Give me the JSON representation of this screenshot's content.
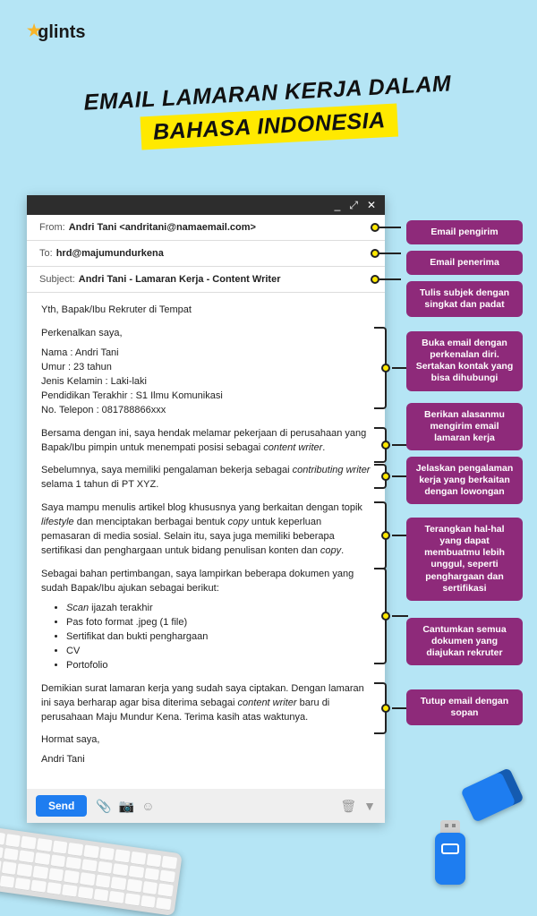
{
  "logo": "glints",
  "title_line1": "EMAIL LAMARAN KERJA DALAM",
  "title_line2": "BAHASA INDONESIA",
  "email": {
    "from_label": "From:",
    "from_value": "Andri Tani <andritani@namaemail.com>",
    "to_label": "To:",
    "to_value": "hrd@majumundurkena",
    "subject_label": "Subject:",
    "subject_value": "Andri Tani - Lamaran Kerja - Content Writer",
    "salutation": "Yth, Bapak/Ibu Rekruter di Tempat",
    "intro_lead": "Perkenalkan saya,",
    "intro_lines": [
      "Nama : Andri Tani",
      "Umur  : 23 tahun",
      "Jenis Kelamin : Laki-laki",
      "Pendidikan Terakhir  : S1 Ilmu Komunikasi",
      "No. Telepon  : 081788866xxx"
    ],
    "reason_html": "Bersama dengan ini, saya hendak melamar pekerjaan di perusahaan yang Bapak/Ibu pimpin untuk menempati posisi sebagai <em>content writer</em>.",
    "experience_html": "Sebelumnya, saya memiliki pengalaman bekerja sebagai <em>contributing writer</em> selama 1 tahun di PT XYZ.",
    "strength_html": "Saya mampu menulis artikel blog khususnya yang berkaitan dengan topik <em>lifestyle</em> dan menciptakan berbagai bentuk <em>copy</em> untuk keperluan pemasaran di media sosial. Selain itu, saya juga memiliki beberapa sertifikasi dan penghargaan untuk bidang penulisan konten dan <em>copy</em>.",
    "docs_lead": "Sebagai bahan pertimbangan, saya lampirkan beberapa dokumen yang sudah Bapak/Ibu ajukan sebagai berikut:",
    "docs": [
      "Scan ijazah terakhir",
      "Pas foto format .jpeg (1 file)",
      "Sertifikat dan bukti penghargaan",
      "CV",
      "Portofolio"
    ],
    "closing_html": "Demikian surat lamaran kerja yang sudah saya ciptakan. Dengan lamaran ini saya berharap agar bisa diterima sebagai <em>content writer</em> baru di perusahaan Maju Mundur Kena. Terima kasih atas waktunya.",
    "signoff1": "Hormat saya,",
    "signoff2": "Andri Tani",
    "send": "Send"
  },
  "annotations": {
    "from": "Email pengirim",
    "to": "Email penerima",
    "subject": "Tulis subjek dengan singkat dan padat",
    "intro": "Buka email dengan perkenalan diri. Sertakan kontak yang bisa dihubungi",
    "reason": "Berikan alasanmu mengirim email lamaran kerja",
    "experience": "Jelaskan pengalaman kerja yang berkaitan dengan lowongan",
    "strength": "Terangkan hal-hal yang dapat membuatmu lebih unggul, seperti penghargaan dan sertifikasi",
    "docs": "Cantumkan semua dokumen yang diajukan rekruter",
    "closing": "Tutup email dengan sopan"
  }
}
